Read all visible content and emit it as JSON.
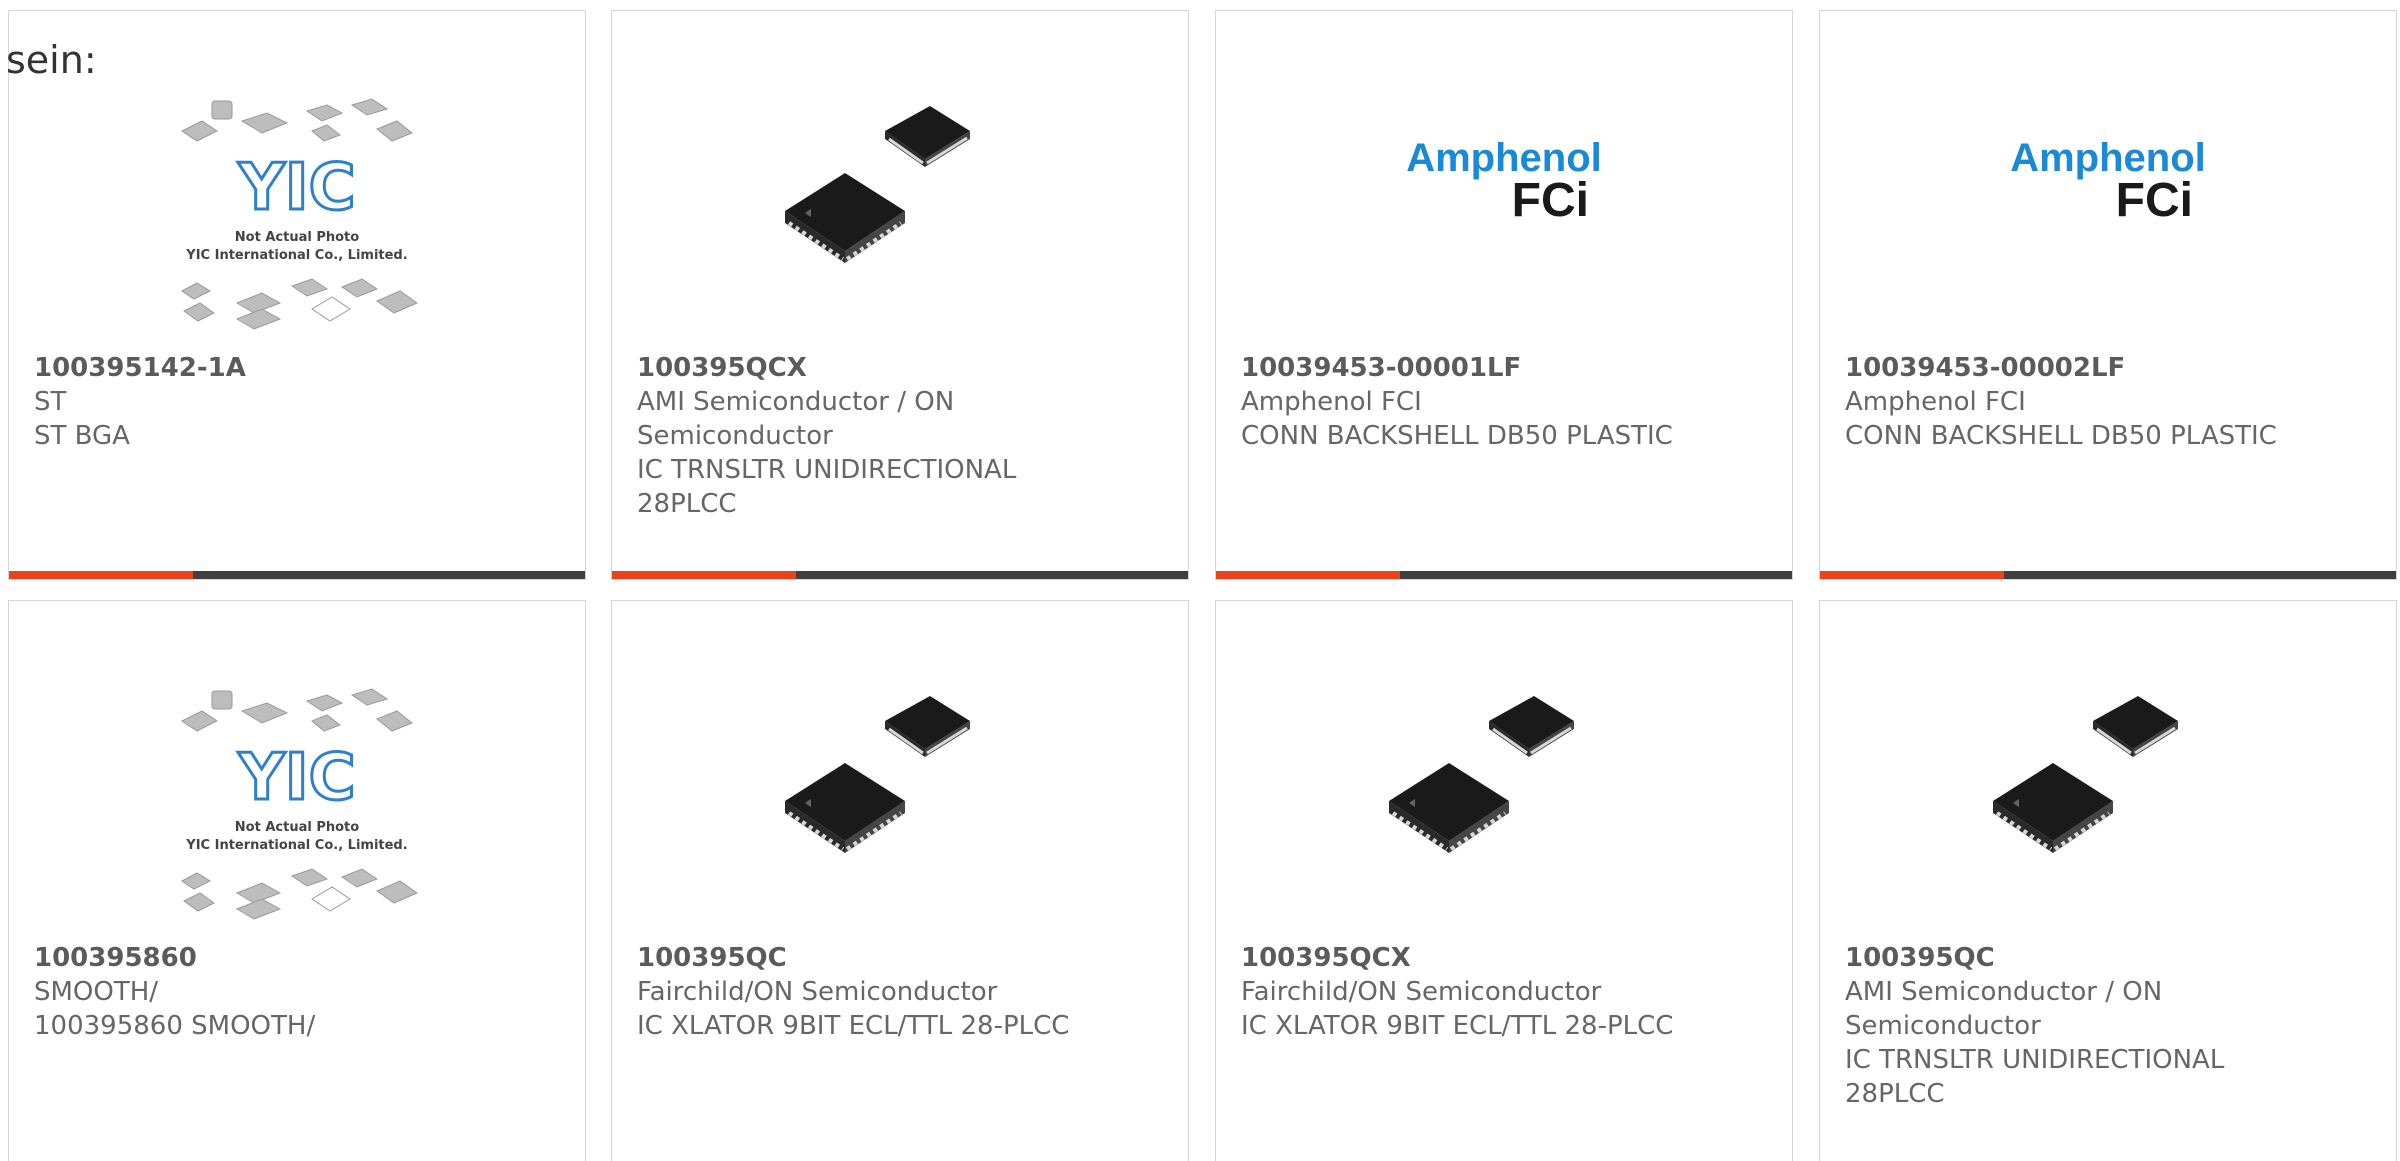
{
  "intro": {
    "text": "sein:"
  },
  "cards": [
    {
      "part_number": "100395142-1A",
      "manufacturer": "ST",
      "description": "ST BGA",
      "image": "yic-placeholder",
      "placeholder_caption_1": "Not Actual Photo",
      "placeholder_caption_2": "YIC International Co., Limited.",
      "placeholder_logo": "YIC"
    },
    {
      "part_number": "100395QCX",
      "manufacturer": "AMI Semiconductor / ON Semiconductor",
      "description": "IC TRNSLTR UNIDIRECTIONAL 28PLCC",
      "image": "plcc-chips"
    },
    {
      "part_number": "10039453-00001LF",
      "manufacturer": "Amphenol FCI",
      "description": "CONN BACKSHELL DB50 PLASTIC",
      "image": "amphenol-logo",
      "logo_line_1": "Amphenol",
      "logo_line_2": "FCi"
    },
    {
      "part_number": "10039453-00002LF",
      "manufacturer": "Amphenol FCI",
      "description": "CONN BACKSHELL DB50 PLASTIC",
      "image": "amphenol-logo",
      "logo_line_1": "Amphenol",
      "logo_line_2": "FCi"
    },
    {
      "part_number": "100395860",
      "manufacturer": "SMOOTH/",
      "description": "100395860 SMOOTH/",
      "image": "yic-placeholder",
      "placeholder_caption_1": "Not Actual Photo",
      "placeholder_caption_2": "YIC International Co., Limited.",
      "placeholder_logo": "YIC"
    },
    {
      "part_number": "100395QC",
      "manufacturer": "Fairchild/ON Semiconductor",
      "description": "IC XLATOR 9BIT ECL/TTL 28-PLCC",
      "image": "plcc-chips"
    },
    {
      "part_number": "100395QCX",
      "manufacturer": "Fairchild/ON Semiconductor",
      "description": "IC XLATOR 9BIT ECL/TTL 28-PLCC",
      "image": "plcc-chips"
    },
    {
      "part_number": "100395QC",
      "manufacturer": "AMI Semiconductor / ON Semiconductor",
      "description": "IC TRNSLTR UNIDIRECTIONAL 28PLCC",
      "image": "plcc-chips"
    }
  ],
  "colors": {
    "accent": "#e8431b",
    "bar": "#3f3f3f",
    "amphenol_blue": "#1a8ad6",
    "yic_blue": "#2f7fc9"
  }
}
